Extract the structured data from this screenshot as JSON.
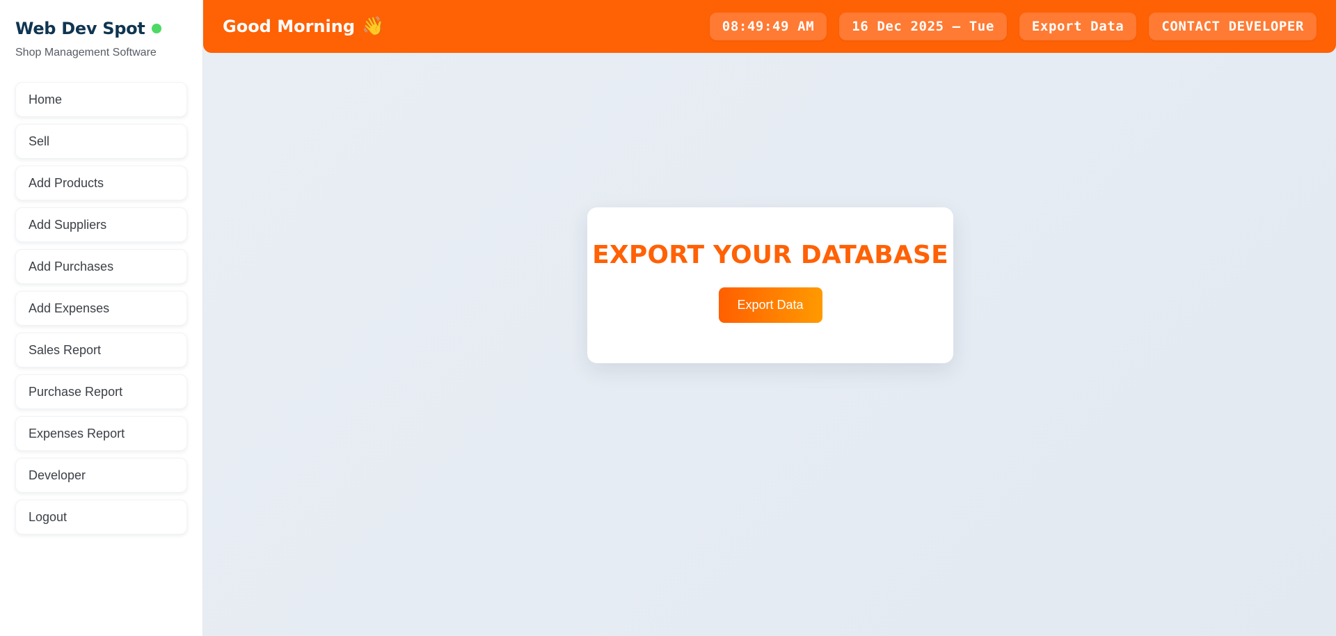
{
  "sidebar": {
    "brand_title": "Web Dev Spot",
    "brand_subtitle": "Shop Management Software",
    "status_color": "#4cd964",
    "items": [
      {
        "label": "Home"
      },
      {
        "label": "Sell"
      },
      {
        "label": "Add Products"
      },
      {
        "label": "Add Suppliers"
      },
      {
        "label": "Add Purchases"
      },
      {
        "label": "Add Expenses"
      },
      {
        "label": "Sales Report"
      },
      {
        "label": "Purchase Report"
      },
      {
        "label": "Expenses Report"
      },
      {
        "label": "Developer"
      },
      {
        "label": "Logout"
      }
    ]
  },
  "header": {
    "greeting": "Good Morning",
    "greeting_icon": "👋",
    "time": "08:49:49 AM",
    "date": "16 Dec 2025 – Tue",
    "export_label": "Export Data",
    "contact_label": "CONTACT DEVELOPER",
    "accent_color": "#ff6105"
  },
  "main": {
    "card_title": "EXPORT YOUR DATABASE",
    "export_button_label": "Export Data"
  }
}
